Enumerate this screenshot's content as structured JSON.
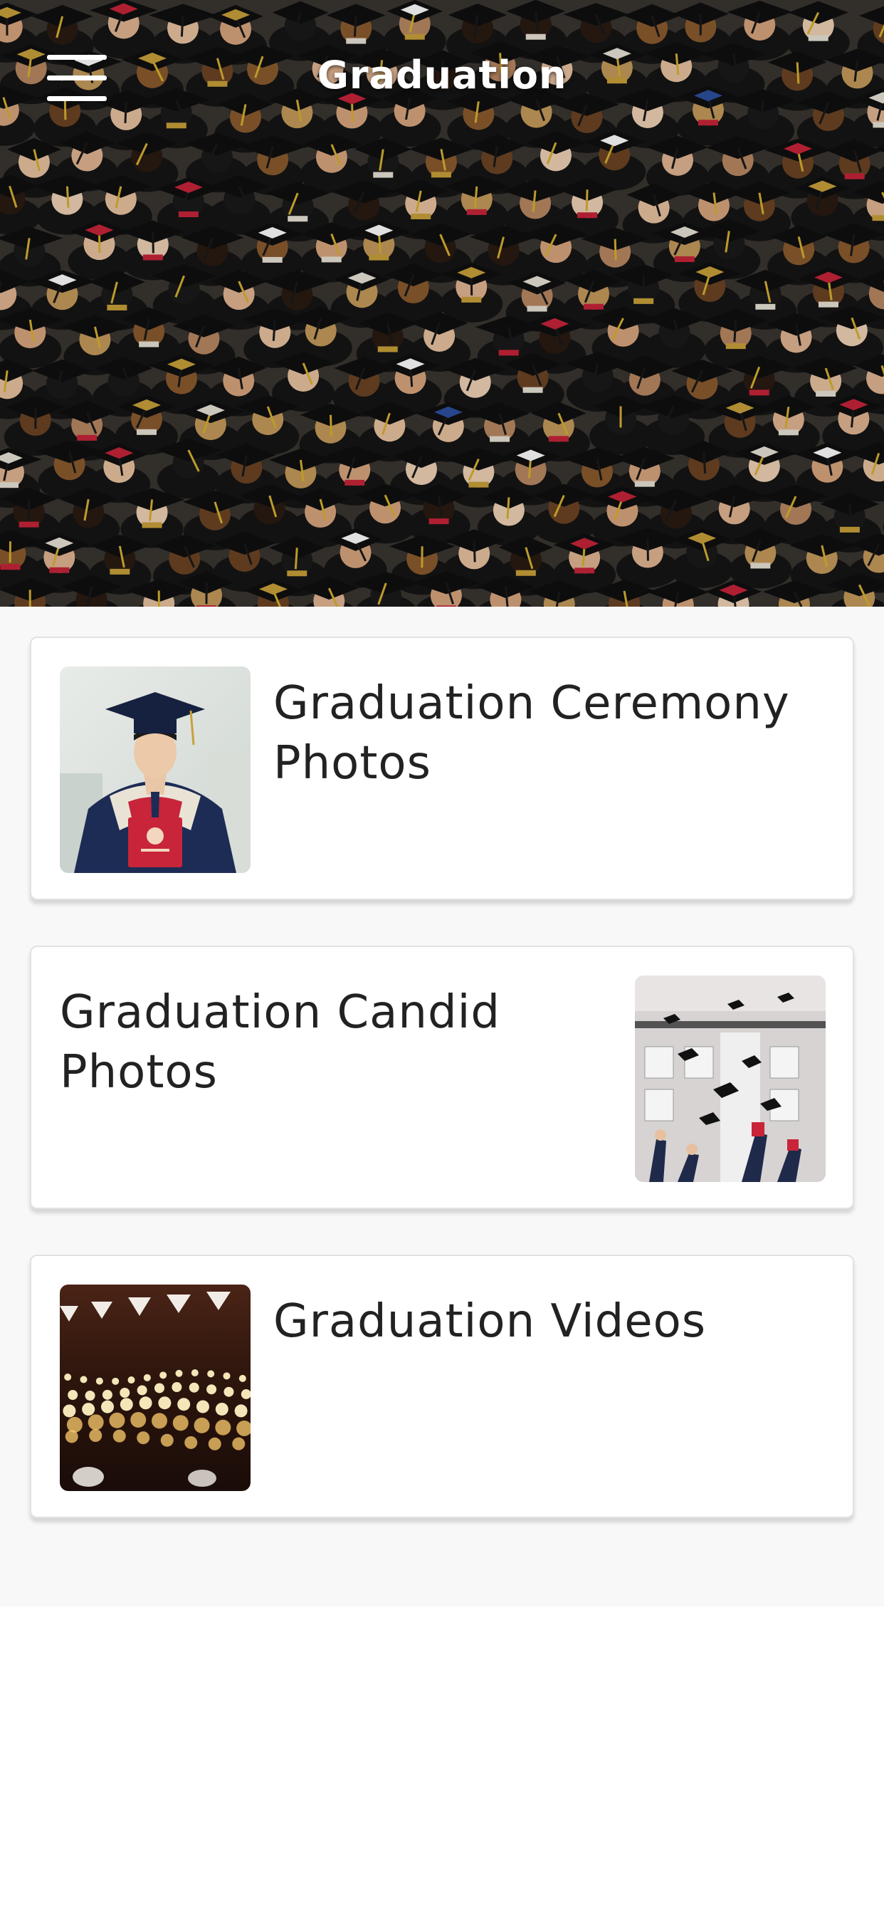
{
  "header": {
    "title": "Graduation",
    "menu_icon": "hamburger-menu-icon",
    "background_image": "graduation-crowd-caps-photo"
  },
  "cards": [
    {
      "title": "Graduation Ceremony Photos",
      "thumbnail": "graduate-portrait-photo",
      "image_side": "left"
    },
    {
      "title": "Graduation Candid Photos",
      "thumbnail": "caps-thrown-in-air-photo",
      "image_side": "right"
    },
    {
      "title": "Graduation Videos",
      "thumbnail": "string-lights-bokeh-photo",
      "image_side": "left"
    }
  ],
  "colors": {
    "header_text": "#ffffff",
    "card_text": "#222222",
    "content_background": "#f8f8f8",
    "card_background": "#ffffff"
  }
}
